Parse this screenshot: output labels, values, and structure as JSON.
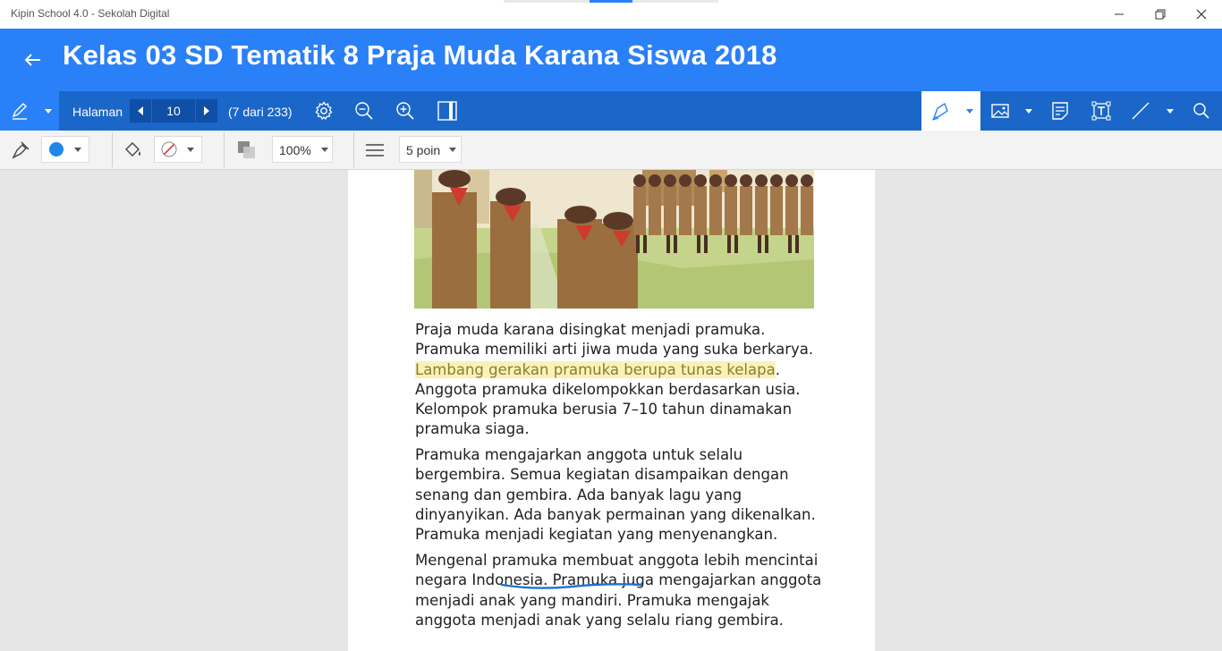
{
  "window": {
    "app_title": "Kipin School 4.0 - Sekolah Digital",
    "controls": [
      "minimize",
      "restore",
      "close"
    ]
  },
  "header": {
    "back_icon": "arrow-left-icon",
    "title": "Kelas 03 SD Tematik 8 Praja Muda Karana Siswa 2018"
  },
  "toolbar": {
    "halaman_label": "Halaman",
    "page_number": "10",
    "page_count_text": "(7 dari 233)",
    "icons": [
      "pen-icon",
      "settings-icon",
      "zoom-out-icon",
      "zoom-in-icon",
      "fit-page-icon",
      "highlighter-icon",
      "image-icon",
      "note-icon",
      "text-box-icon",
      "line-icon",
      "search-icon"
    ]
  },
  "format_bar": {
    "stroke_color": "#1e88e5",
    "zoom": "100%",
    "thickness": "5 poin",
    "icons": [
      "paint-brush-icon",
      "fill-bucket-icon",
      "no-fill-icon",
      "opacity-icon",
      "line-weight-icon"
    ]
  },
  "document": {
    "paragraph1_plain_a": "Praja muda karana disingkat menjadi pramuka. Pramuka memiliki arti jiwa muda yang suka berkarya. ",
    "paragraph1_highlight": "Lambang gerakan pramuka berupa tunas kelapa",
    "paragraph1_plain_b": ". Anggota pramuka dikelompokkan berdasarkan usia. Kelompok pramuka berusia 7–10 tahun dinamakan pramuka siaga.",
    "paragraph2": "Pramuka mengajarkan anggota untuk selalu bergembira. Semua kegiatan disampaikan dengan senang dan gembira. Ada banyak lagu yang dinyanyikan. Ada banyak permainan yang dikenalkan. Pramuka menjadi kegiatan yang menyenangkan.",
    "paragraph3": "Mengenal pramuka membuat anggota lebih mencintai negara Indonesia. Pramuka juga mengajarkan anggota menjadi anak yang mandiri. Pramuka mengajak anggota menjadi anak yang selalu riang gembira.",
    "ink_annotation_color": "#1e6fd9",
    "highlight_color": "#fbf1b8"
  },
  "colors": {
    "header_blue": "#2a80f7",
    "toolbar_blue": "#1b66c9"
  }
}
